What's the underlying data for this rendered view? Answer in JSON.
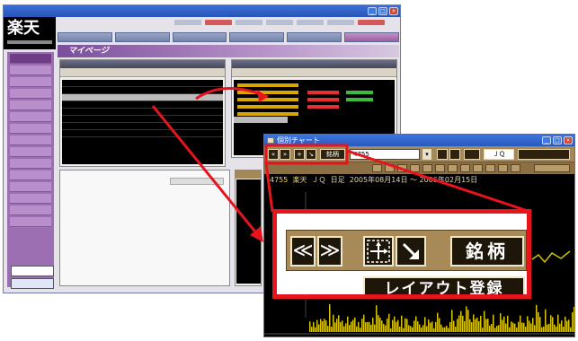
{
  "back_window": {
    "logo_text": "楽天",
    "banner_text": "マイページ"
  },
  "chart_window": {
    "title": "個別チャート",
    "toolbar": {
      "code_input_value": "4755",
      "button_meigara": "銘柄",
      "market_select": "ＪＱ"
    },
    "chart_header": {
      "code": "4755",
      "name": "楽天",
      "market": "ＪＱ",
      "period": "日足",
      "date_range": "2005年08月14日 ～ 2006年02月15日"
    }
  },
  "zoom": {
    "prev_label": "≪",
    "next_label": "≫",
    "meigara_label": "銘柄",
    "layout_register_label": "レイアウト登録"
  },
  "colors": {
    "accent_red": "#e6141d",
    "toolbar_brown": "#a88a58",
    "sidebar_purple": "#9b6fb1"
  }
}
